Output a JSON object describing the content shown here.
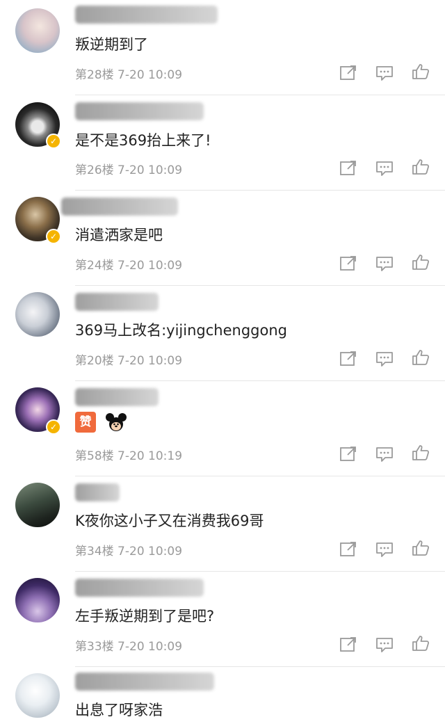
{
  "comments": [
    {
      "text": "叛逆期到了",
      "floor": "第28楼",
      "time": "7-20 10:09",
      "verified": false
    },
    {
      "text": "是不是369抬上来了!",
      "floor": "第26楼",
      "time": "7-20 10:09",
      "verified": true
    },
    {
      "text": "消遣洒家是吧",
      "floor": "第24楼",
      "time": "7-20 10:09",
      "verified": true
    },
    {
      "text": "369马上改名:yijingchenggong",
      "floor": "第20楼",
      "time": "7-20 10:09",
      "verified": false
    },
    {
      "text": "",
      "emojis": [
        "赞",
        "mickey"
      ],
      "floor": "第58楼",
      "time": "7-20 10:19",
      "verified": true
    },
    {
      "text": "K夜你这小子又在消费我69哥",
      "floor": "第34楼",
      "time": "7-20 10:09",
      "verified": false
    },
    {
      "text": "左手叛逆期到了是吧?",
      "floor": "第33楼",
      "time": "7-20 10:09",
      "verified": false
    },
    {
      "text": "出息了呀家浩",
      "floor": "",
      "time": "",
      "verified": false
    }
  ],
  "icons": {
    "share": "share-icon",
    "reply": "comment-icon",
    "like": "thumbs-up-icon"
  },
  "colors": {
    "meta": "#9a9a9a",
    "text": "#222222",
    "badge": "#f5b400",
    "divider": "#e6e6e6"
  }
}
